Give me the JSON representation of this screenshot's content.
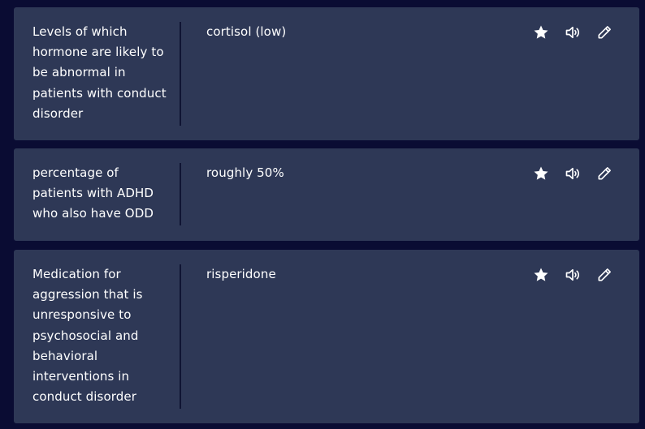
{
  "cards": [
    {
      "term": "Levels of which hormone are likely to be abnormal in patients with conduct disorder",
      "definition": "cortisol (low)"
    },
    {
      "term": "percentage of patients with ADHD who also have ODD",
      "definition": "roughly 50%"
    },
    {
      "term": "Medication for aggression that is unresponsive to psychosocial and behavioral interventions in conduct disorder",
      "definition": "risperidone"
    }
  ],
  "icons": {
    "star": "star-icon",
    "audio": "speaker-icon",
    "edit": "pencil-icon"
  },
  "colors": {
    "page_background": "#0a0c33",
    "card_background": "#2e3856",
    "divider": "#0f1433",
    "text": "#ffffff"
  }
}
